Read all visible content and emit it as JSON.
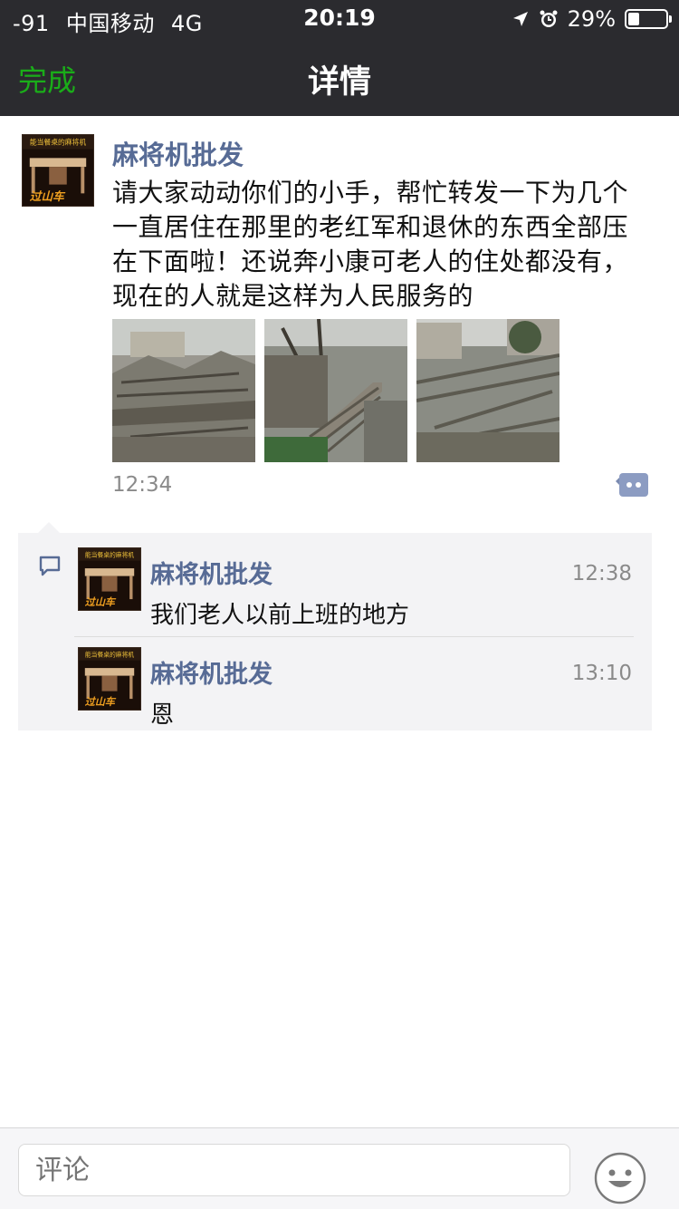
{
  "status_bar": {
    "signal": "-91",
    "carrier": "中国移动",
    "network": "4G",
    "time": "20:19",
    "battery": "29%",
    "icons": [
      "location-icon",
      "alarm-icon",
      "battery-icon"
    ]
  },
  "nav": {
    "done_label": "完成",
    "title": "详情"
  },
  "post": {
    "author": "麻将机批发",
    "text": "请大家动动你们的小手，帮忙转发一下为几个一直居住在那里的老红军和退休的东西全部压在下面啦！还说奔小康可老人的住处都没有，现在的人就是这样为人民服务的",
    "time": "12:34",
    "photos": [
      "collapsed-building-photo-1",
      "collapsed-stairs-photo-2",
      "fallen-trees-photo-3"
    ],
    "avatar_banner": "能当餐桌的麻将机",
    "avatar_slogan": "过山车"
  },
  "comments": [
    {
      "author": "麻将机批发",
      "text": "我们老人以前上班的地方",
      "time": "12:38"
    },
    {
      "author": "麻将机批发",
      "text": "恩",
      "time": "13:10"
    }
  ],
  "input": {
    "placeholder": "评论"
  },
  "colors": {
    "nav_bg": "#2b2b2f",
    "accent_green": "#1aad19",
    "name_blue": "#576b95",
    "comment_bg": "#f3f3f5"
  }
}
